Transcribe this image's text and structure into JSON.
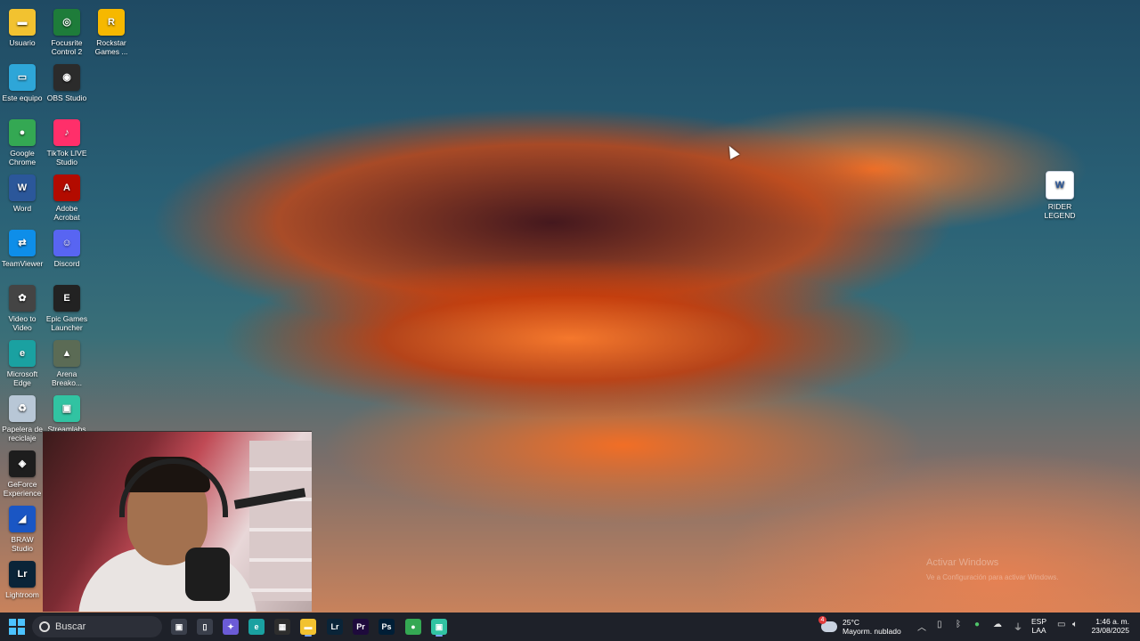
{
  "desktop": {
    "icons_left": [
      {
        "name": "Usuario",
        "icon": "folder-icon",
        "color": "#f2c230"
      },
      {
        "name": "Focusrite Control 2",
        "icon": "focusrite-icon",
        "color": "#1e7c3a"
      },
      {
        "name": "Rockstar Games ...",
        "icon": "rockstar-icon",
        "color": "#f6b800"
      },
      {
        "name": "Este equipo",
        "icon": "computer-icon",
        "color": "#2ea6d8"
      },
      {
        "name": "OBS Studio",
        "icon": "obs-icon",
        "color": "#2b2b2b"
      },
      {
        "name": "Google Chrome",
        "icon": "chrome-icon",
        "color": "#34a853"
      },
      {
        "name": "TikTok LIVE Studio",
        "icon": "tiktok-icon",
        "color": "#ff2f6a"
      },
      {
        "name": "Word",
        "icon": "word-icon",
        "color": "#2b579a"
      },
      {
        "name": "Adobe Acrobat",
        "icon": "acrobat-icon",
        "color": "#b30b00"
      },
      {
        "name": "TeamViewer",
        "icon": "teamviewer-icon",
        "color": "#0e8ee9"
      },
      {
        "name": "Discord",
        "icon": "discord-icon",
        "color": "#5865f2"
      },
      {
        "name": "Video to Video",
        "icon": "film-icon",
        "color": "#444"
      },
      {
        "name": "Epic Games Launcher",
        "icon": "epic-icon",
        "color": "#222"
      },
      {
        "name": "Microsoft Edge",
        "icon": "edge-icon",
        "color": "#1aa1a1"
      },
      {
        "name": "Arena Breako...",
        "icon": "arena-icon",
        "color": "#5b6b55"
      },
      {
        "name": "Papelera de reciclaje",
        "icon": "recycle-bin-icon",
        "color": "#b8c7d6"
      },
      {
        "name": "Streamlabs Desktop",
        "icon": "streamlabs-icon",
        "color": "#31c3a2"
      },
      {
        "name": "GeForce Experience",
        "icon": "nvidia-icon",
        "color": "#1d1d1d"
      },
      {
        "name": "BRAW Studio",
        "icon": "braw-icon",
        "color": "#1a56c4"
      },
      {
        "name": "Lightroom",
        "icon": "lightroom-icon",
        "color": "#0a2438"
      }
    ],
    "icon_right": {
      "name": "RIDER LEGEND",
      "icon": "word-document-icon",
      "color": "#2b579a"
    },
    "watermark": {
      "line1": "Activar Windows",
      "line2": "Ve a Configuración para activar Windows."
    }
  },
  "taskbar": {
    "search_placeholder": "Buscar",
    "apps": [
      {
        "name": "task-view-button",
        "icon": "task-view-icon",
        "label": "▣",
        "color": "#3a3f4b"
      },
      {
        "name": "files-button",
        "icon": "file-icon",
        "label": "▯",
        "color": "#3a3f4b"
      },
      {
        "name": "copilot-button",
        "icon": "copilot-icon",
        "label": "✦",
        "color": "#6b5bd6"
      },
      {
        "name": "edge-button",
        "icon": "edge-icon",
        "label": "e",
        "color": "#1aa1a1"
      },
      {
        "name": "store-button",
        "icon": "store-icon",
        "label": "▦",
        "color": "#2e2e2e"
      },
      {
        "name": "explorer-button",
        "icon": "folder-icon",
        "label": "▬",
        "color": "#f2c230"
      },
      {
        "name": "lightroom-button",
        "icon": "lightroom-icon",
        "label": "Lr",
        "color": "#0a2438"
      },
      {
        "name": "premiere-button",
        "icon": "premiere-icon",
        "label": "Pr",
        "color": "#1e0a3c"
      },
      {
        "name": "photoshop-button",
        "icon": "photoshop-icon",
        "label": "Ps",
        "color": "#001e36"
      },
      {
        "name": "chrome-button",
        "icon": "chrome-icon",
        "label": "●",
        "color": "#34a853"
      },
      {
        "name": "streamlabs-button",
        "icon": "streamlabs-icon",
        "label": "▣",
        "color": "#31c3a2"
      }
    ],
    "weather": {
      "temp": "25°C",
      "desc": "Mayorm. nublado",
      "badge": "4"
    },
    "lang": {
      "line1": "ESP",
      "line2": "LAA"
    },
    "clock": {
      "time": "1:46 a. m.",
      "date": "23/08/2025"
    }
  }
}
